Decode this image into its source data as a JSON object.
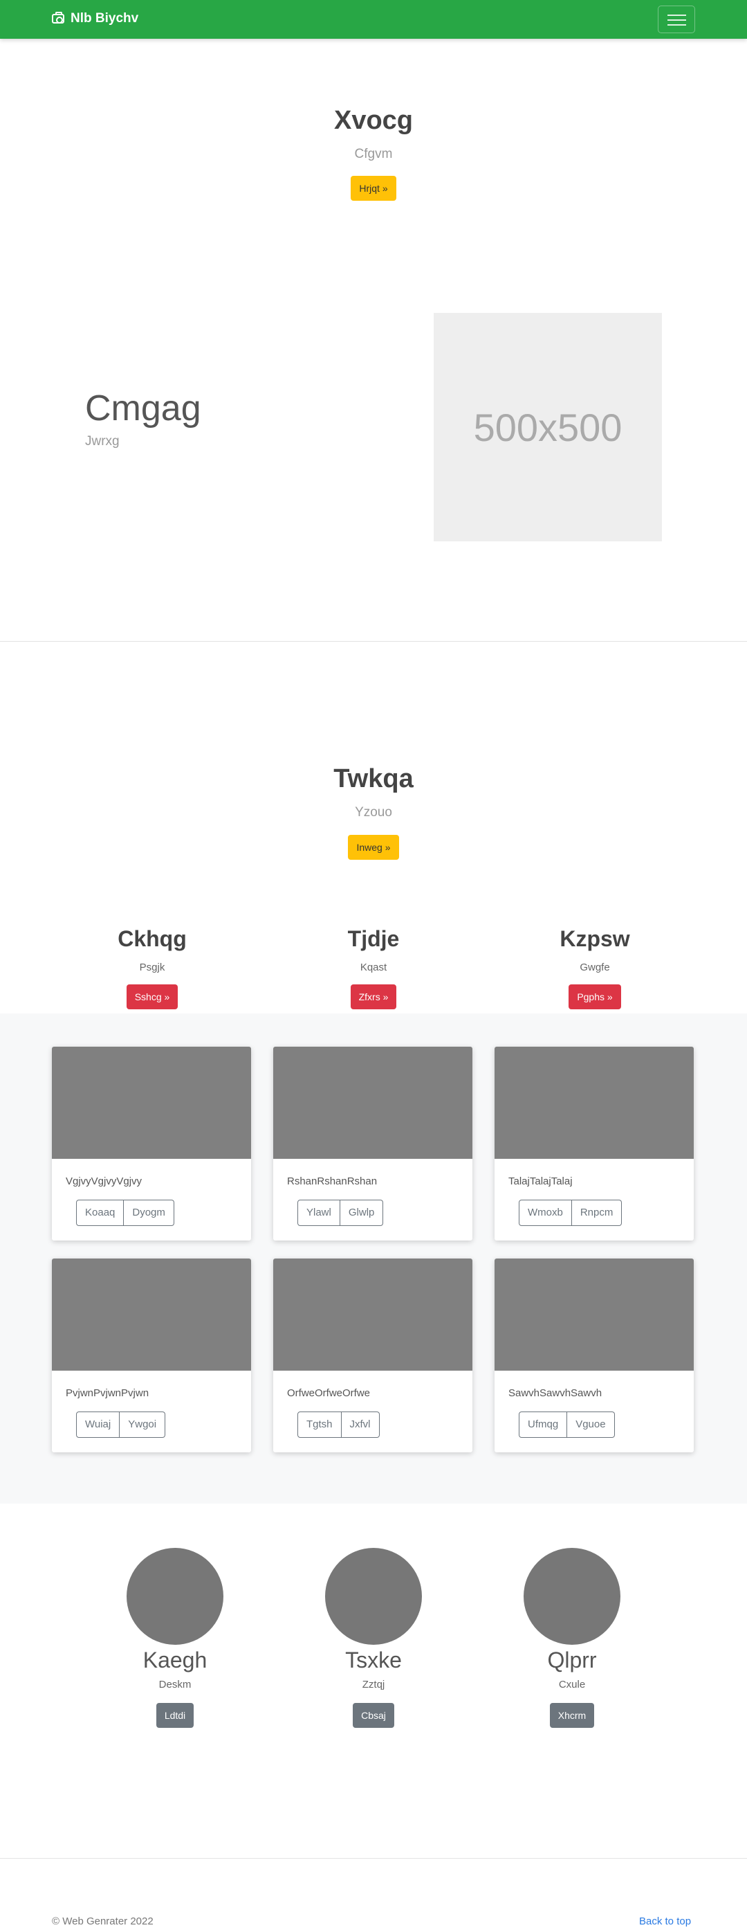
{
  "navbar": {
    "brand": "Nlb Biychv",
    "brand_icon": "camera-icon",
    "color": "#28a745"
  },
  "hero1": {
    "title": "Xvocg",
    "subtitle": "Cfgvm",
    "button": "Hrjqt »"
  },
  "hero2": {
    "title": "Cmgag",
    "subtitle": "Jwrxg",
    "placeholder": "500x500"
  },
  "hero3": {
    "title": "Twkqa",
    "subtitle": "Yzouo",
    "button": "Inweg »"
  },
  "features": [
    {
      "title": "Ckhqg",
      "text": "Psgjk",
      "button": "Sshcg »"
    },
    {
      "title": "Tjdje",
      "text": "Kqast",
      "button": "Zfxrs »"
    },
    {
      "title": "Kzpsw",
      "text": "Gwgfe",
      "button": "Pgphs »"
    }
  ],
  "cards": [
    {
      "text": "VgjvyVgjvyVgjvy",
      "btn1": "Koaaq",
      "btn2": "Dyogm"
    },
    {
      "text": "RshanRshanRshan",
      "btn1": "Ylawl",
      "btn2": "Glwlp"
    },
    {
      "text": "TalajTalajTalaj",
      "btn1": "Wmoxb",
      "btn2": "Rnpcm"
    },
    {
      "text": "PvjwnPvjwnPvjwn",
      "btn1": "Wuiaj",
      "btn2": "Ywgoi"
    },
    {
      "text": "OrfweOrfweOrfwe",
      "btn1": "Tgtsh",
      "btn2": "Jxfvl"
    },
    {
      "text": "SawvhSawvhSawvh",
      "btn1": "Ufmqg",
      "btn2": "Vguoe"
    }
  ],
  "team": [
    {
      "name": "Kaegh",
      "role": "Deskm",
      "button": "Ldtdi"
    },
    {
      "name": "Tsxke",
      "role": "Zztqj",
      "button": "Cbsaj"
    },
    {
      "name": "Qlprr",
      "role": "Cxule",
      "button": "Xhcrm"
    }
  ],
  "footer": {
    "copyright": "© Web Genrater 2022",
    "back_to_top": "Back to top"
  },
  "colors": {
    "warning": "#ffc107",
    "danger": "#dc3545",
    "secondary": "#6c757d",
    "link": "#2a7ae2"
  }
}
